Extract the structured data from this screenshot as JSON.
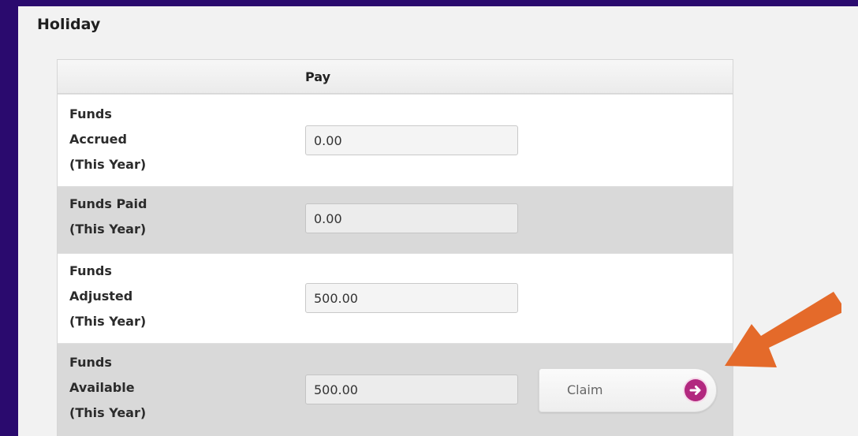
{
  "section": {
    "title": "Holiday"
  },
  "table": {
    "header": {
      "pay": "Pay"
    },
    "rows": [
      {
        "label_lines": [
          "Funds",
          "Accrued",
          "(This Year)"
        ],
        "value": "0.00"
      },
      {
        "label_lines": [
          "Funds Paid",
          "(This Year)"
        ],
        "value": "0.00"
      },
      {
        "label_lines": [
          "Funds",
          "Adjusted",
          "(This Year)"
        ],
        "value": "500.00"
      },
      {
        "label_lines": [
          "Funds",
          "Available",
          "(This Year)"
        ],
        "value": "500.00"
      }
    ]
  },
  "claim_button": {
    "label": "Claim",
    "icon": "arrow-right-circle-icon"
  },
  "annotation": {
    "icon": "orange-arrow-icon"
  },
  "colors": {
    "background": "#2a0a6e",
    "panel": "#f2f2f2",
    "row_grey": "#d9d9d9",
    "claim_icon": "#b2287f",
    "arrow": "#e46a2a"
  }
}
